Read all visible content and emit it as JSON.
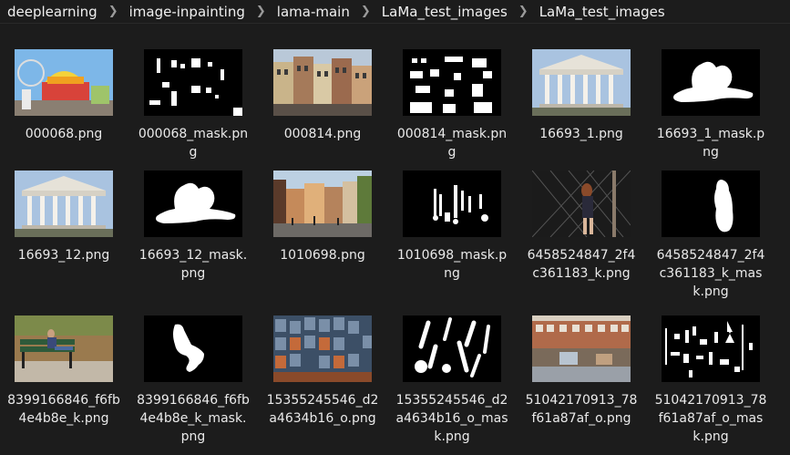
{
  "breadcrumb": [
    "deeplearning",
    "image-inpainting",
    "lama-main",
    "LaMa_test_images",
    "LaMa_test_images"
  ],
  "files": [
    {
      "name": "000068.png",
      "thumb": "amusement"
    },
    {
      "name": "000068_mask.png",
      "thumb": "mask-scattered"
    },
    {
      "name": "000814.png",
      "thumb": "buildings"
    },
    {
      "name": "000814_mask.png",
      "thumb": "mask-blocks"
    },
    {
      "name": "16693_1.png",
      "thumb": "columns"
    },
    {
      "name": "16693_1_mask.png",
      "thumb": "mask-blob"
    },
    {
      "name": "16693_12.png",
      "thumb": "columns"
    },
    {
      "name": "16693_12_mask.png",
      "thumb": "mask-blob"
    },
    {
      "name": "1010698.png",
      "thumb": "street"
    },
    {
      "name": "1010698_mask.png",
      "thumb": "mask-figures"
    },
    {
      "name": "6458524847_2f4c361183_k.png",
      "thumb": "fence"
    },
    {
      "name": "6458524847_2f4c361183_k_mask.png",
      "thumb": "mask-person"
    },
    {
      "name": "8399166846_f6fb4e4b8e_k.png",
      "thumb": "bench"
    },
    {
      "name": "8399166846_f6fb4e4b8e_k_mask.png",
      "thumb": "mask-sitting"
    },
    {
      "name": "15355245546_d2a4634b16_o.png",
      "thumb": "facade"
    },
    {
      "name": "15355245546_d2a4634b16_o_mask.png",
      "thumb": "mask-strokes"
    },
    {
      "name": "51042170913_78f61a87af_o.png",
      "thumb": "city"
    },
    {
      "name": "51042170913_78f61a87af_o_mask.png",
      "thumb": "mask-fragments"
    }
  ]
}
